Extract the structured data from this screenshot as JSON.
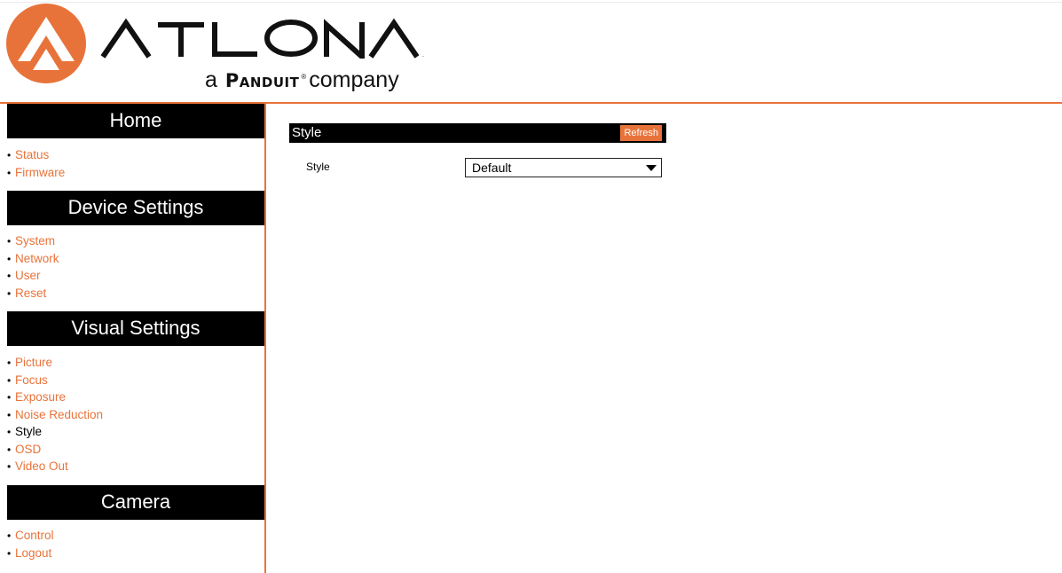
{
  "brand": {
    "name": "ATLONA",
    "tagline_prefix": "a",
    "tagline_brand": "Panduit",
    "tagline_reg": "®",
    "tagline_suffix": "company",
    "accent_color": "#e8733a",
    "logo_icon": "atlona-logo-icon"
  },
  "sidebar": {
    "sections": [
      {
        "title": "Home",
        "items": [
          {
            "label": "Status"
          },
          {
            "label": "Firmware"
          }
        ]
      },
      {
        "title": "Device Settings",
        "items": [
          {
            "label": "System"
          },
          {
            "label": "Network"
          },
          {
            "label": "User"
          },
          {
            "label": "Reset"
          }
        ]
      },
      {
        "title": "Visual Settings",
        "items": [
          {
            "label": "Picture"
          },
          {
            "label": "Focus"
          },
          {
            "label": "Exposure"
          },
          {
            "label": "Noise Reduction"
          },
          {
            "label": "Style",
            "active": true
          },
          {
            "label": "OSD"
          },
          {
            "label": "Video Out"
          }
        ]
      },
      {
        "title": "Camera",
        "items": [
          {
            "label": "Control"
          },
          {
            "label": "Logout"
          }
        ]
      }
    ],
    "bullet": "•"
  },
  "main": {
    "panel_title": "Style",
    "refresh_label": "Refresh",
    "style_field": {
      "label": "Style",
      "value": "Default"
    }
  }
}
